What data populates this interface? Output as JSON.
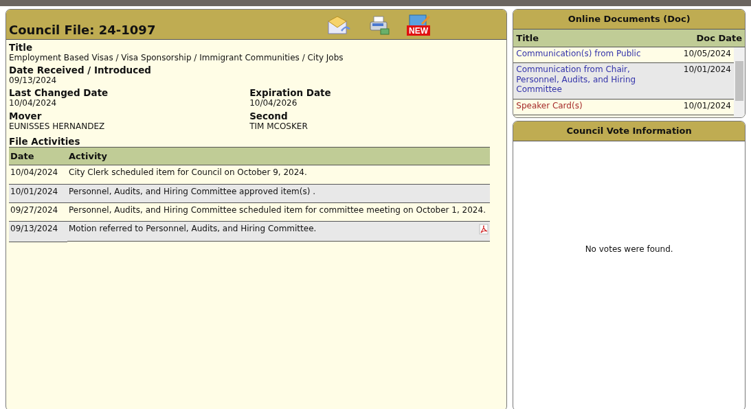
{
  "file": {
    "title": "Council File: 24-1097",
    "new_badge": "NEW",
    "fields": [
      {
        "label": "Title",
        "value": "Employment Based Visas / Visa Sponsorship / Immigrant Communities / City Jobs"
      },
      {
        "label": "Date Received / Introduced",
        "value": "09/13/2024"
      }
    ],
    "pairs": [
      [
        {
          "label": "Last Changed Date",
          "value": "10/04/2024"
        },
        {
          "label": "Expiration Date",
          "value": "10/04/2026"
        }
      ],
      [
        {
          "label": "Mover",
          "value": "EUNISSES HERNANDEZ"
        },
        {
          "label": "Second",
          "value": "TIM MCOSKER"
        }
      ]
    ],
    "activities_title": "File Activities",
    "activities": {
      "columns": [
        "Date",
        "Activity"
      ],
      "rows": [
        {
          "date": "10/04/2024",
          "activity": "City Clerk scheduled item for Council on October 9, 2024.",
          "attachment": false
        },
        {
          "date": "10/01/2024",
          "activity": "Personnel, Audits, and Hiring Committee approved item(s) .",
          "attachment": false
        },
        {
          "date": "09/27/2024",
          "activity": "Personnel, Audits, and Hiring Committee scheduled item for committee meeting on October 1, 2024.",
          "attachment": false
        },
        {
          "date": "09/13/2024",
          "activity": "Motion referred to Personnel, Audits, and Hiring Committee.",
          "attachment": true
        }
      ]
    }
  },
  "documents": {
    "title": "Online Documents (Doc)",
    "columns": [
      "Title",
      "Doc Date"
    ],
    "rows": [
      {
        "title": "Communication(s) from Public",
        "date": "10/05/2024",
        "color": "#3333aa"
      },
      {
        "title": "Communication from Chair, Personnel, Audits, and Hiring Committee",
        "date": "10/01/2024",
        "color": "#3333aa"
      },
      {
        "title": "Speaker Card(s)",
        "date": "10/01/2024",
        "color": "#a52a2a"
      }
    ]
  },
  "votes": {
    "title": "Council Vote Information",
    "message": "No votes were found."
  }
}
